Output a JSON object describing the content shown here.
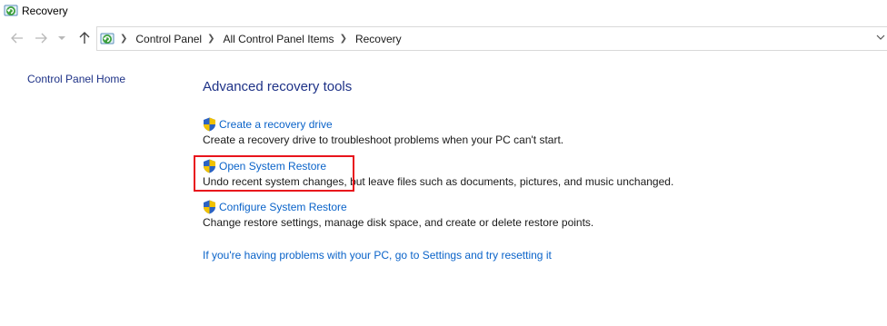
{
  "window": {
    "title": "Recovery"
  },
  "nav": {
    "back_icon": "arrow-left-icon",
    "forward_icon": "arrow-right-icon",
    "recent_icon": "chevron-down-icon",
    "up_icon": "arrow-up-icon"
  },
  "breadcrumb": {
    "items": [
      "Control Panel",
      "All Control Panel Items",
      "Recovery"
    ]
  },
  "sidebar": {
    "home_link": "Control Panel Home"
  },
  "main": {
    "heading": "Advanced recovery tools",
    "tasks": [
      {
        "link": "Create a recovery drive",
        "description": "Create a recovery drive to troubleshoot problems when your PC can't start."
      },
      {
        "link": "Open System Restore",
        "description": "Undo recent system changes, but leave files such as documents, pictures, and music unchanged."
      },
      {
        "link": "Configure System Restore",
        "description": "Change restore settings, manage disk space, and create or delete restore points."
      }
    ],
    "reset_link": "If you're having problems with your PC, go to Settings and try resetting it"
  },
  "colors": {
    "heading": "#1e3287",
    "link": "#0a63c9",
    "highlight": "#e8141c"
  }
}
